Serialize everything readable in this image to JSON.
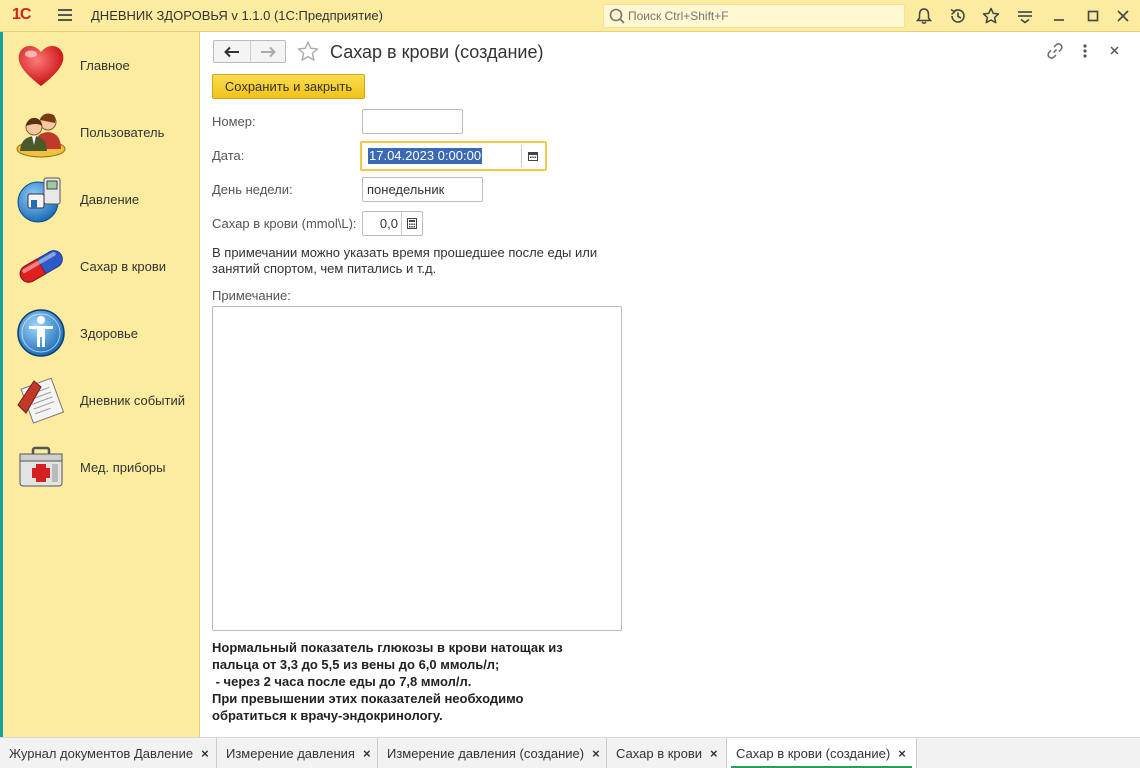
{
  "app": {
    "logo": "1С",
    "title": "ДНЕВНИК ЗДОРОВЬЯ v 1.1.0  (1С:Предприятие)",
    "search_placeholder": "Поиск Ctrl+Shift+F",
    "toolbar_icons": [
      "bell-icon",
      "history-icon",
      "star-icon",
      "menu-lines-icon",
      "minimize-icon",
      "maximize-icon",
      "close-icon"
    ]
  },
  "sidebar": {
    "items": [
      {
        "label": "Главное",
        "icon": "heart-icon"
      },
      {
        "label": "Пользователь",
        "icon": "users-icon"
      },
      {
        "label": "Давление",
        "icon": "tonometer-icon"
      },
      {
        "label": "Сахар в крови",
        "icon": "pill-icon"
      },
      {
        "label": "Здоровье",
        "icon": "person-circle-icon"
      },
      {
        "label": "Дневник событий",
        "icon": "journal-icon"
      },
      {
        "label": "Мед. приборы",
        "icon": "first-aid-kit-icon"
      }
    ]
  },
  "form": {
    "title": "Сахар в крови (создание)",
    "save_label": "Сохранить и закрыть",
    "fields": {
      "number_label": "Номер:",
      "number_value": "",
      "date_label": "Дата:",
      "date_value": "17.04.2023  0:00:00",
      "weekday_label": "День недели:",
      "weekday_value": "понедельник",
      "sugar_label": "Сахар в крови (mmol\\L):",
      "sugar_value": "0,0"
    },
    "hint_line1": "В примечании можно указать время прошедшее после еды или",
    "hint_line2": "занятий спортом, чем питались и т.д.",
    "note_label": "Примечание:",
    "note_value": "",
    "info_lines": [
      "Нормальный показатель глюкозы в крови натощак из",
      "пальца от 3,3 до 5,5  из вены до 6,0 ммоль/л;",
      " - через 2 часа после еды до 7,8 ммол/л.",
      "При превышении этих показателей необходимо",
      "обратиться к врачу-эндокринологу."
    ]
  },
  "tabs": [
    {
      "label": "Журнал документов Давление",
      "close": "×"
    },
    {
      "label": "Измерение давления",
      "close": "×"
    },
    {
      "label": "Измерение давления (создание)",
      "close": "×"
    },
    {
      "label": "Сахар в крови",
      "close": "×"
    },
    {
      "label": "Сахар в крови (создание)",
      "close": "×",
      "active": true
    }
  ],
  "colors": {
    "panel": "#fbeca0",
    "accent_button": "#f1c21b",
    "selection": "#3b6ab5",
    "active_tab_underline": "#2a9d5b"
  }
}
